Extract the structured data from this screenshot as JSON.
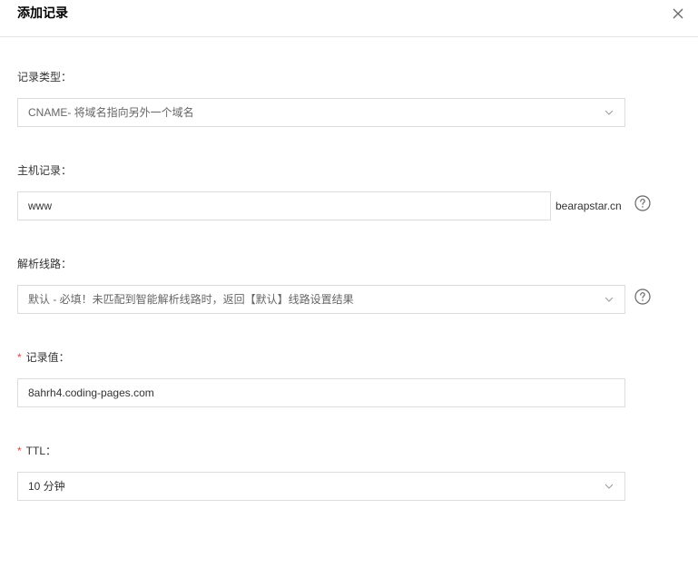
{
  "dialog": {
    "title": "添加记录"
  },
  "form": {
    "record_type": {
      "label": "记录类型：",
      "value": "CNAME- 将域名指向另外一个域名"
    },
    "host": {
      "label": "主机记录：",
      "value": "www",
      "suffix": "bearapstar.cn"
    },
    "line": {
      "label": "解析线路：",
      "value": "默认 - 必填！未匹配到智能解析线路时，返回【默认】线路设置结果"
    },
    "record_value": {
      "required_mark": "*",
      "label": "记录值：",
      "value": "8ahrh4.coding-pages.com"
    },
    "ttl": {
      "required_mark": "*",
      "label": "TTL：",
      "value": "10 分钟"
    }
  },
  "icons": {
    "close": "close-icon",
    "chevron": "chevron-down-icon",
    "help": "question-circle-icon"
  },
  "colors": {
    "border": "#dcdcdc",
    "required": "#e54545",
    "text": "#333333",
    "muted": "#666666"
  }
}
